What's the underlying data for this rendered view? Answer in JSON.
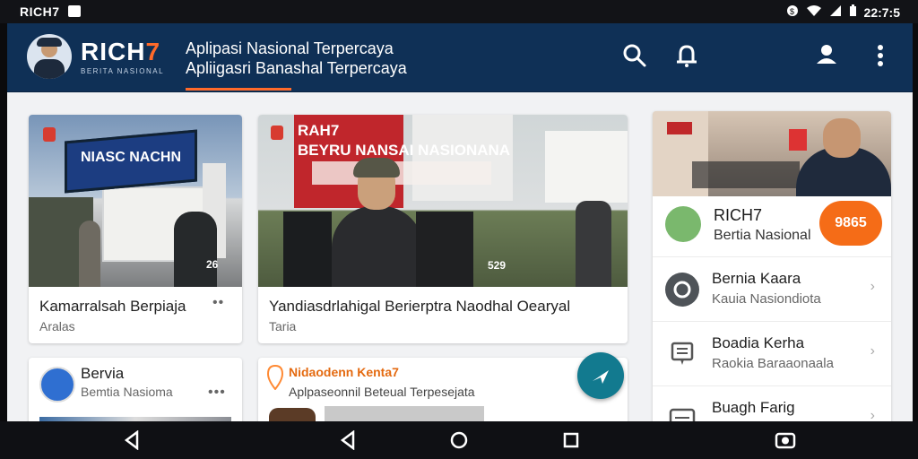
{
  "status_bar": {
    "brand": "RICH7",
    "time": "22:7:5"
  },
  "app_bar": {
    "brand_main": "RICH",
    "brand_accent": "7",
    "brand_subtitle": "BERITA NASIONAL",
    "tagline_line1": "Aplipasi Nasional Terpercaya",
    "tagline_line2": "Apliigasri Banashal Terpercaya",
    "icons": [
      "search-icon",
      "notification-icon",
      "profile-icon",
      "more-vert-icon"
    ]
  },
  "cards": {
    "left_top": {
      "banner_text": "NIASC NACHN",
      "counter": "26",
      "title": "Kamarralsah Berpiaja",
      "subtitle": "Aralas"
    },
    "center_top": {
      "banner_line1": "RAH7",
      "banner_line2": "BEYRU NANSAI NASIONANA",
      "counter": "529",
      "title": "Yandiasdrlahigal Berierptra Naodhal Oearyal",
      "subtitle": "Taria"
    },
    "left_bottom": {
      "title": "Bervia",
      "subtitle": "Bemtia Nasioma"
    },
    "center_bottom": {
      "title": "Nidaodenn Kenta7",
      "subtitle": "Aplpaseonnil Beteual Terpesejata"
    }
  },
  "right_panel": {
    "profile_title": "RICH7",
    "profile_subtitle": "Bertia Nasional",
    "badge": "9865",
    "rows": [
      {
        "title": "Bernia Kaara",
        "subtitle": "Kauia Nasiondiota",
        "icon": "settings-icon"
      },
      {
        "title": "Boadia Kerha",
        "subtitle": "Raokia Baraaonaala",
        "icon": "message-icon"
      },
      {
        "title": "Buagh Farig",
        "subtitle": "",
        "icon": "document-icon"
      }
    ]
  },
  "nav_bar": {
    "icons": [
      "back-icon",
      "back-icon",
      "home-icon",
      "recent-apps-icon",
      "screenshot-icon"
    ]
  },
  "colors": {
    "app_bar_bg": "#0f3056",
    "accent_orange": "#ff6a2a",
    "fab_teal": "#127a8f"
  }
}
